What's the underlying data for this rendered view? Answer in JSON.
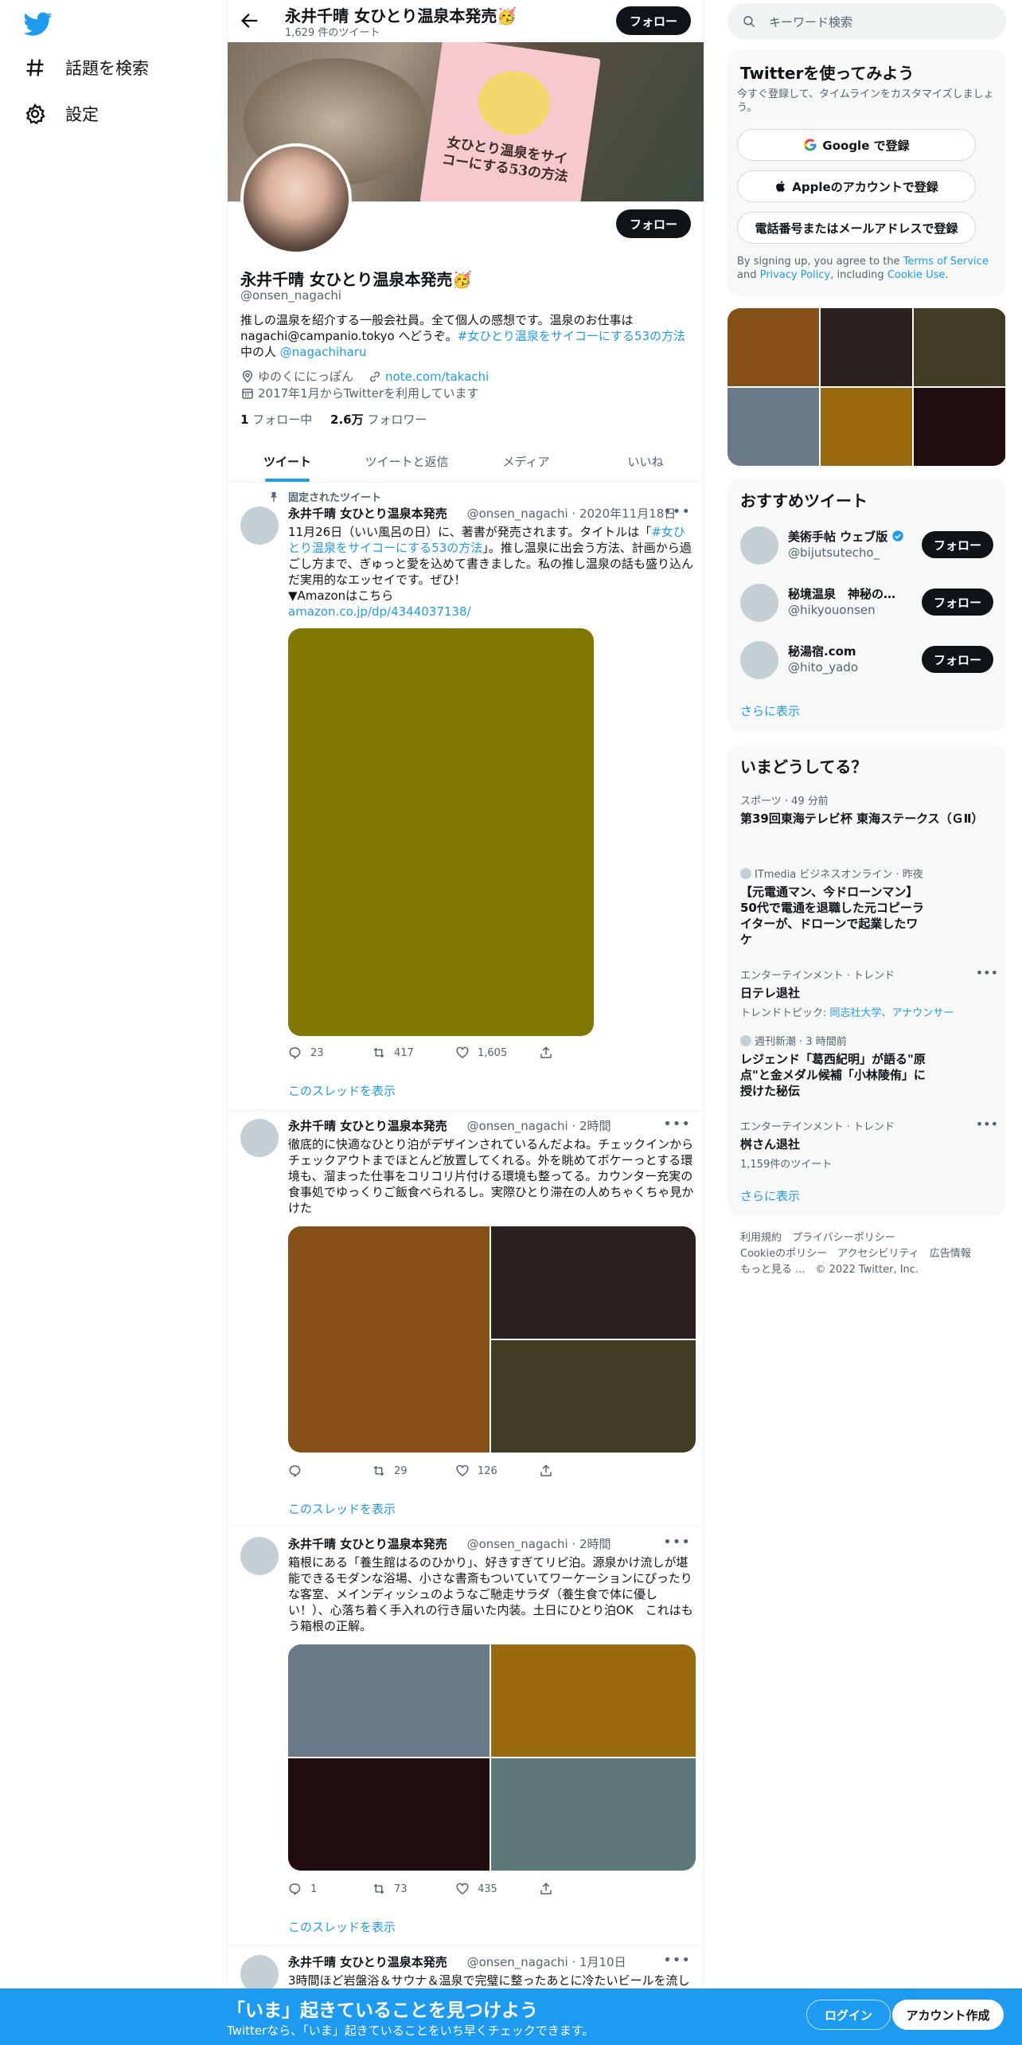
{
  "nav": {
    "explore": "話題を検索",
    "settings": "設定"
  },
  "header": {
    "name": "永井千晴 女ひとり温泉本発売🥳",
    "tweet_count": "1,629 件のツイート",
    "follow": "フォロー"
  },
  "banner_book": {
    "title": "女ひとり温泉をサイコーにする53の方法"
  },
  "profile": {
    "name": "永井千晴 女ひとり温泉本発売🥳",
    "handle": "@onsen_nagachi",
    "follow": "フォロー",
    "bio_1": "推しの温泉を紹介する一般会社員。全て個人の感想です。温泉のお仕事は nagachi@campanio.tokyo へどうぞ。",
    "bio_hashtag": "#女ひとり温泉をサイコーにする53の方法",
    "bio_2": " 中の人 ",
    "bio_mention": "@nagachiharu",
    "location": "ゆのくににっぽん",
    "url": "note.com/takachi",
    "joined": "2017年1月からTwitterを利用しています",
    "following_count": "1",
    "following_label": "フォロー中",
    "followers_count": "2.6万",
    "followers_label": "フォロワー"
  },
  "tabs": [
    "ツイート",
    "ツイートと返信",
    "メディア",
    "いいね"
  ],
  "pinned_label": "固定されたツイート",
  "tweets": [
    {
      "name": "永井千晴 女ひとり温泉本発売",
      "handle": "@onsen_nagachi",
      "time": "2020年11月18日",
      "text_1": "11月26日（いい風呂の日）に、著書が発売されます。タイトルは「",
      "hashtag": "#女ひとり温泉をサイコーにする53の方法",
      "text_2": "」。推し温泉に出会う方法、計画から過ごし方まで、ぎゅっと愛を込めて書きました。私の推し温泉の話も盛り込んだ実用的なエッセイです。ぜひ！",
      "text_3": "▼Amazonはこちら",
      "link": "amazon.co.jp/dp/4344037138/",
      "replies": "23",
      "retweets": "417",
      "likes": "1,605",
      "thread": "このスレッドを表示",
      "media_color": "#807800"
    },
    {
      "name": "永井千晴 女ひとり温泉本発売",
      "handle": "@onsen_nagachi",
      "time": "2時間",
      "text": "徹底的に快適なひとり泊がデザインされているんだよね。チェックインからチェックアウトまでほとんど放置してくれる。外を眺めてボケーっとする環境も、溜まった仕事をコリコリ片付ける環境も整ってる。カウンター充実の食事処でゆっくりご飯食べられるし。実際ひとり滞在の人めちゃくちゃ見かけた",
      "replies": "",
      "retweets": "29",
      "likes": "126",
      "thread": "このスレッドを表示",
      "media_colors": [
        "#854f18",
        "#2b2220",
        "#433c25"
      ]
    },
    {
      "name": "永井千晴 女ひとり温泉本発売",
      "handle": "@onsen_nagachi",
      "time": "2時間",
      "text": "箱根にある「養生館はるのひかり」、好きすぎてリピ泊。源泉かけ流しが堪能できるモダンな浴場、小さな書斎もついていてワーケーションにぴったりな客室、メインディッシュのようなご馳走サラダ（養生食で体に優しい！）、心落ち着く手入れの行き届いた内装。土日にひとり泊OK　これはもう箱根の正解。",
      "replies": "1",
      "retweets": "73",
      "likes": "435",
      "thread": "このスレッドを表示",
      "media_colors": [
        "#6b7a88",
        "#9a6a0e",
        "#200c0d",
        "#5d7878"
      ]
    },
    {
      "name": "永井千晴 女ひとり温泉本発売",
      "handle": "@onsen_nagachi",
      "time": "1月10日",
      "text": "3時間ほど岩盤浴＆サウナ＆温泉で完璧に整ったあとに冷たいビールを流し"
    }
  ],
  "right": {
    "search_placeholder": "キーワード検索",
    "signup": {
      "title": "Twitterを使ってみよう",
      "sub": "今すぐ登録して、タイムラインをカスタマイズしましょう。",
      "google": "Google で登録",
      "apple": "Appleのアカウントで登録",
      "phone": "電話番号またはメールアドレスで登録",
      "terms_1": "By signing up, you agree to the ",
      "terms_link": "Terms of Service",
      "terms_2": " and ",
      "privacy_link": "Privacy Policy",
      "terms_3": ", including ",
      "cookie_link": "Cookie Use",
      "terms_4": "."
    },
    "photo_colors": [
      "#854f18",
      "#2b2220",
      "#433c25",
      "#6b7a88",
      "#9a6a0e",
      "#200c0d"
    ],
    "recommend": {
      "title": "おすすめツイート",
      "users": [
        {
          "name": "美術手帖 ウェブ版",
          "handle": "@bijutsutecho_",
          "verified": true
        },
        {
          "name": "秘境温泉　神秘の湯...",
          "handle": "@hikyouonsen",
          "verified": false
        },
        {
          "name": "秘湯宿.com",
          "handle": "@hito_yado",
          "verified": false
        }
      ],
      "follow": "フォロー",
      "more": "さらに表示"
    },
    "trends": {
      "title": "いまどうしてる？",
      "items": [
        {
          "ctx": "スポーツ · 49 分前",
          "title": "第39回東海テレビ杯 東海ステークス（ＧⅡ）",
          "sub": ""
        },
        {
          "ctx": "ITmedia ビジネスオンライン · 昨夜",
          "title": "【元電通マン、今ドローンマン】50代で電通を退職した元コピーライターが、ドローンで起業したワケ",
          "sub": ""
        },
        {
          "ctx": "エンターテインメント · トレンド",
          "title": "日テレ退社",
          "sub": "トレンドトピック: ",
          "sub_link": "同志社大学、アナウンサー"
        },
        {
          "ctx": "週刊新潮 · 3 時間前",
          "title": "レジェンド「葛西紀明」が語る\"原点\"と金メダル候補「小林陵侑」に授けた秘伝",
          "sub": ""
        },
        {
          "ctx": "エンターテインメント · トレンド",
          "title": "桝さん退社",
          "sub": "1,159件のツイート"
        }
      ],
      "more": "さらに表示"
    },
    "footer": {
      "line1": "利用規約　プライバシーポリシー",
      "line2": "Cookieのポリシー　アクセシビリティ　広告情報",
      "line3": "もっと見る ...　© 2022 Twitter, Inc."
    }
  },
  "bottom": {
    "title": "「いま」起きていることを見つけよう",
    "sub": "Twitterなら、「いま」起きていることをいち早くチェックできます。",
    "login": "ログイン",
    "signup": "アカウント作成"
  }
}
